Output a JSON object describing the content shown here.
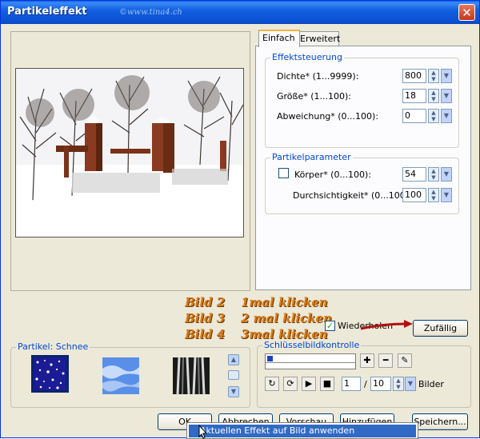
{
  "window": {
    "title": "Partikeleffekt",
    "watermark": "©www.tina4.ch",
    "close_glyph": "✕"
  },
  "tabs": [
    {
      "label": "Einfach",
      "active": true
    },
    {
      "label": "Erweitert",
      "active": false
    }
  ],
  "effektsteuerung": {
    "legend": "Effektsteuerung",
    "rows": [
      {
        "label": "Dichte* (1...9999):",
        "value": "800"
      },
      {
        "label": "Größe* (1...100):",
        "value": "18"
      },
      {
        "label": "Abweichung* (0...100):",
        "value": "0"
      }
    ]
  },
  "partikelparameter": {
    "legend": "Partikelparameter",
    "koerper": {
      "label": "Körper* (0...100):",
      "value": "54",
      "checked": false
    },
    "durchsichtigkeit": {
      "label": "Durchsichtigkeit* (0...100):",
      "value": "100"
    }
  },
  "annotations": [
    {
      "left": "Bild 2",
      "right": "1mal klicken"
    },
    {
      "left": "Bild 3",
      "right": "2 mal klicken"
    },
    {
      "left": "Bild 4",
      "right": "3mal klicken"
    }
  ],
  "wiederholen": {
    "label": "Wiederholen",
    "checked": true,
    "check_glyph": "✓"
  },
  "zufaellig_button": "Zufällig",
  "partikel_group": {
    "legend": "Partikel: Schnee",
    "thumbs": [
      "snow-particle",
      "blue-cloud-particle",
      "black-streak-particle"
    ]
  },
  "schluessel": {
    "legend": "Schlüsselbildkontrolle",
    "frame": "1",
    "total": "10",
    "separator": "/",
    "unit": "Bilder"
  },
  "buttons": {
    "ok": "OK",
    "abbrechen": "Abbrechen",
    "vorschau": "Vorschau",
    "hinzufuegen": "Hinzufügen",
    "speichern": "Speichern..."
  },
  "context_menu": {
    "item": "Aktuellen Effekt auf Bild anwenden"
  },
  "colors": {
    "title_bar": "#0b4fd1",
    "legend_text": "#0046d5",
    "annotation": "#d87a12",
    "arrow": "#b01010",
    "menu_highlight": "#316ac5"
  }
}
